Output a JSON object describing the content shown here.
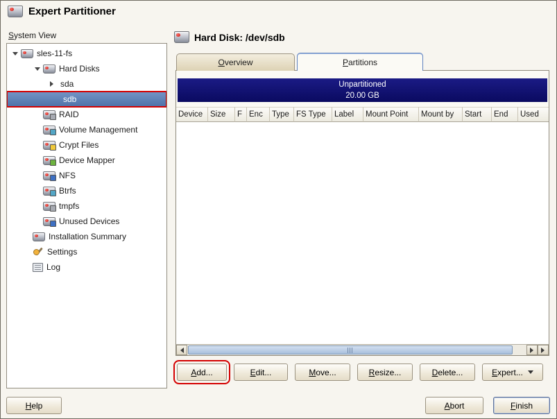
{
  "window": {
    "title": "Expert Partitioner"
  },
  "sidebar": {
    "label": "System View",
    "items": [
      {
        "label": "sles-11-fs",
        "icon": "system-disk-icon",
        "expanded": true
      },
      {
        "label": "Hard Disks",
        "icon": "hard-disks-icon",
        "expanded": true
      },
      {
        "label": "sda",
        "collapsed": true
      },
      {
        "label": "sdb",
        "selected": true,
        "highlighted": true
      },
      {
        "label": "RAID",
        "icon": "raid-icon"
      },
      {
        "label": "Volume Management",
        "icon": "volume-management-icon"
      },
      {
        "label": "Crypt Files",
        "icon": "crypt-files-icon"
      },
      {
        "label": "Device Mapper",
        "icon": "device-mapper-icon"
      },
      {
        "label": "NFS",
        "icon": "nfs-icon"
      },
      {
        "label": "Btrfs",
        "icon": "btrfs-icon"
      },
      {
        "label": "tmpfs",
        "icon": "tmpfs-icon"
      },
      {
        "label": "Unused Devices",
        "icon": "unused-devices-icon"
      },
      {
        "label": "Installation Summary",
        "icon": "installation-summary-icon"
      },
      {
        "label": "Settings",
        "icon": "settings-icon"
      },
      {
        "label": "Log",
        "icon": "log-icon"
      }
    ]
  },
  "main": {
    "title": "Hard Disk: /dev/sdb",
    "tabs": [
      {
        "label": "Overview",
        "active": false
      },
      {
        "label": "Partitions",
        "active": true
      }
    ],
    "banner": {
      "line1": "Unpartitioned",
      "line2": "20.00 GB"
    },
    "table": {
      "columns": [
        "Device",
        "Size",
        "F",
        "Enc",
        "Type",
        "FS Type",
        "Label",
        "Mount Point",
        "Mount by",
        "Start",
        "End",
        "Used"
      ],
      "rows": []
    },
    "actions": [
      {
        "label": "Add..."
      },
      {
        "label": "Edit..."
      },
      {
        "label": "Move..."
      },
      {
        "label": "Resize..."
      },
      {
        "label": "Delete..."
      },
      {
        "label": "Expert...",
        "menu": true
      }
    ]
  },
  "footer": {
    "help": "Help",
    "abort": "Abort",
    "finish": "Finish"
  },
  "annotations": {
    "highlight_color": "#d40000",
    "targets": [
      "sidebar-item-sdb",
      "add-button"
    ]
  },
  "colors": {
    "selection_blue": "#5d80ba",
    "banner_navy": "#0d0d70",
    "tab_active_border": "#5f82c0"
  }
}
